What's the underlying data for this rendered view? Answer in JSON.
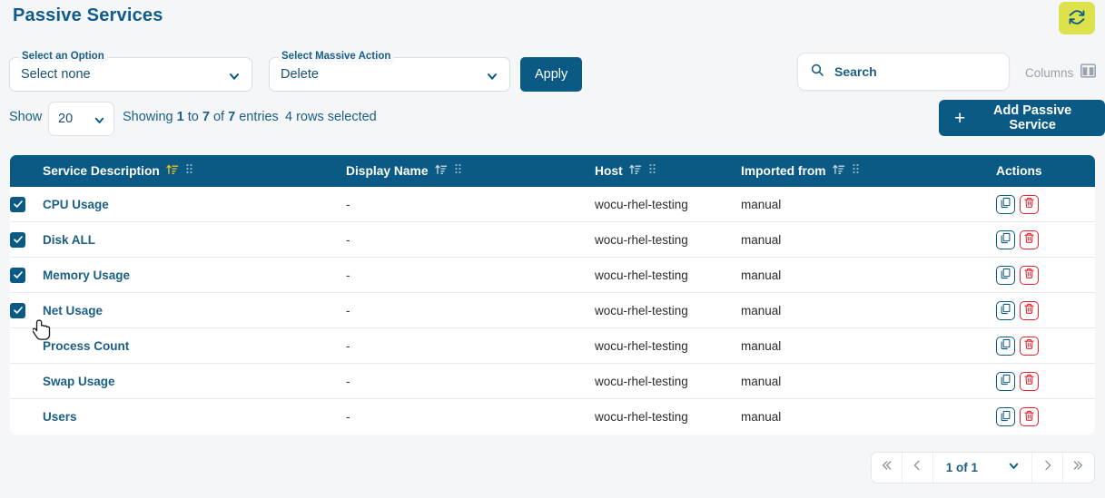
{
  "header": {
    "title": "Passive Services",
    "refresh_icon": "refresh-icon",
    "refresh_bg": "#dde24c"
  },
  "filters": {
    "option_select": {
      "label": "Select an Option",
      "value": "Select none",
      "chevron_icon": "chevron-down-icon"
    },
    "massive_action_select": {
      "label": "Select Massive Action",
      "value": "Delete",
      "chevron_icon": "chevron-down-icon"
    },
    "apply_label": "Apply"
  },
  "search": {
    "placeholder": "Search",
    "icon": "search-icon"
  },
  "columns_control": {
    "label": "Columns",
    "icon": "columns-icon"
  },
  "toolbar": {
    "show_label": "Show",
    "show_value": "20",
    "showing_prefix": "Showing ",
    "showing_from": "1",
    "showing_mid": " to ",
    "showing_to": "7",
    "showing_of": " of ",
    "showing_total": "7",
    "showing_suffix": " entries",
    "rows_selected": "4 rows selected",
    "add_label": "Add Passive Service",
    "add_icon": "plus-icon"
  },
  "table": {
    "columns": [
      {
        "key": "check",
        "label": "",
        "sort_icon": "",
        "grip_icon": ""
      },
      {
        "key": "desc",
        "label": "Service Description",
        "sort_icon": "sort-asc-icon",
        "sort_active": true,
        "grip_icon": "grip-icon"
      },
      {
        "key": "disp",
        "label": "Display Name",
        "sort_icon": "sort-asc-icon",
        "sort_active": false,
        "grip_icon": "grip-icon"
      },
      {
        "key": "host",
        "label": "Host",
        "sort_icon": "sort-asc-icon",
        "sort_active": false,
        "grip_icon": "grip-icon"
      },
      {
        "key": "imp",
        "label": "Imported from",
        "sort_icon": "sort-asc-icon",
        "sort_active": false,
        "grip_icon": "grip-icon"
      },
      {
        "key": "act",
        "label": "Actions",
        "sort_icon": "",
        "grip_icon": ""
      }
    ],
    "rows": [
      {
        "checked": true,
        "service_description": "CPU Usage",
        "display_name": "-",
        "host": "wocu-rhel-testing",
        "imported_from": "manual"
      },
      {
        "checked": true,
        "service_description": "Disk ALL",
        "display_name": "-",
        "host": "wocu-rhel-testing",
        "imported_from": "manual"
      },
      {
        "checked": true,
        "service_description": "Memory Usage",
        "display_name": "-",
        "host": "wocu-rhel-testing",
        "imported_from": "manual"
      },
      {
        "checked": true,
        "service_description": "Net Usage",
        "display_name": "-",
        "host": "wocu-rhel-testing",
        "imported_from": "manual"
      },
      {
        "checked": false,
        "service_description": "Process Count",
        "display_name": "-",
        "host": "wocu-rhel-testing",
        "imported_from": "manual"
      },
      {
        "checked": false,
        "service_description": "Swap Usage",
        "display_name": "-",
        "host": "wocu-rhel-testing",
        "imported_from": "manual"
      },
      {
        "checked": false,
        "service_description": "Users",
        "display_name": "-",
        "host": "wocu-rhel-testing",
        "imported_from": "manual"
      }
    ],
    "row_actions": {
      "copy_icon": "copy-icon",
      "copy_color": "#0a5a85",
      "delete_icon": "trash-icon",
      "delete_color": "#e8232a"
    }
  },
  "pagination": {
    "first_icon": "chevron-double-left-icon",
    "prev_icon": "chevron-left-icon",
    "page_text": "1 of 1",
    "page_chevron_icon": "chevron-down-icon",
    "next_icon": "chevron-right-icon",
    "last_icon": "chevron-double-right-icon"
  },
  "cursor": {
    "icon": "pointer-hand-cursor"
  },
  "colors": {
    "primary": "#0a5a85",
    "accent_yellow": "#dde24c",
    "sort_active": "#e8c31e",
    "danger": "#e8232a",
    "page_bg": "#f4f6f8"
  }
}
